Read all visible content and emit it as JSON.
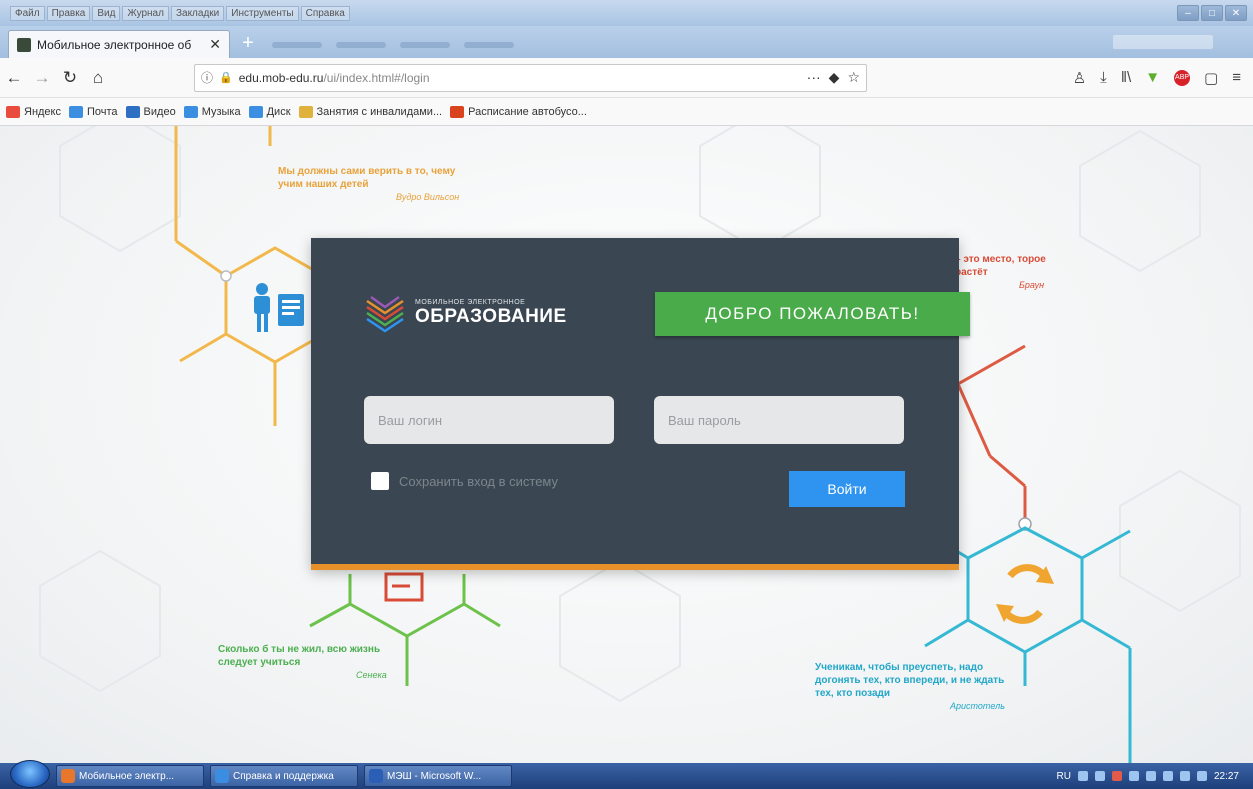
{
  "browser": {
    "menu": [
      "Файл",
      "Правка",
      "Вид",
      "Журнал",
      "Закладки",
      "Инструменты",
      "Справка"
    ],
    "window_buttons": [
      "–",
      "□",
      "✕"
    ],
    "tab": {
      "title": "Мобильное электронное об",
      "close": "✕"
    },
    "new_tab": "+",
    "url": {
      "info": "ⓘ",
      "lock": "🔒",
      "domain": "edu.mob-edu.ru",
      "path": "/ui/index.html#/login",
      "more": "···",
      "pocket": "◆",
      "star": "☆"
    },
    "nav": {
      "back": "←",
      "forward": "→",
      "reload": "↻",
      "home": "⌂"
    },
    "toolbar_icons": {
      "account": "♙",
      "download": "⤓",
      "library": "‖\\",
      "extension": "▼",
      "adblock": "ABP",
      "sidebar": "▢",
      "menu": "≡"
    },
    "bookmarks": [
      {
        "label": "Яндекс",
        "color": "#e94b3c"
      },
      {
        "label": "Почта",
        "color": "#3b8ee0"
      },
      {
        "label": "Видео",
        "color": "#2e6fc1"
      },
      {
        "label": "Музыка",
        "color": "#3b8ee0"
      },
      {
        "label": "Диск",
        "color": "#3b8ee0"
      },
      {
        "label": "Занятия с инвалидами...",
        "color": "#e0b23b"
      },
      {
        "label": "Расписание автобусо...",
        "color": "#d9431e"
      }
    ]
  },
  "quotes": [
    {
      "text": "Мы должны сами верить в то, чему учим наших детей",
      "author": "Вудро Вильсон",
      "color": "#e8a23a"
    },
    {
      "text": "– это место, торое растёт",
      "author": "Браун",
      "color": "#d94b36"
    },
    {
      "text": "Сколько б ты не жил, всю жизнь следует учиться",
      "author": "Сенека",
      "color": "#4caf50"
    },
    {
      "text": "Ученикам, чтобы преуспеть, надо догонять тех, кто впереди, и не ждать тех, кто позади",
      "author": "Аристотель",
      "color": "#21a7c8"
    }
  ],
  "login": {
    "logo_top": "МОБИЛЬНОЕ ЭЛЕКТРОННОЕ",
    "logo_main": "ОБРАЗОВАНИЕ",
    "welcome": "ДОБРО ПОЖАЛОВАТЬ!",
    "login_placeholder": "Ваш логин",
    "password_placeholder": "Ваш пароль",
    "remember_label": "Сохранить вход в систему",
    "submit": "Войти"
  },
  "taskbar": {
    "tasks": [
      {
        "label": "Мобильное электр...",
        "color": "#e8762b"
      },
      {
        "label": "Справка и поддержка",
        "color": "#3a8de0"
      },
      {
        "label": "МЭШ - Microsoft W...",
        "color": "#2b5fb5"
      }
    ],
    "lang": "RU",
    "time": "22:27"
  }
}
